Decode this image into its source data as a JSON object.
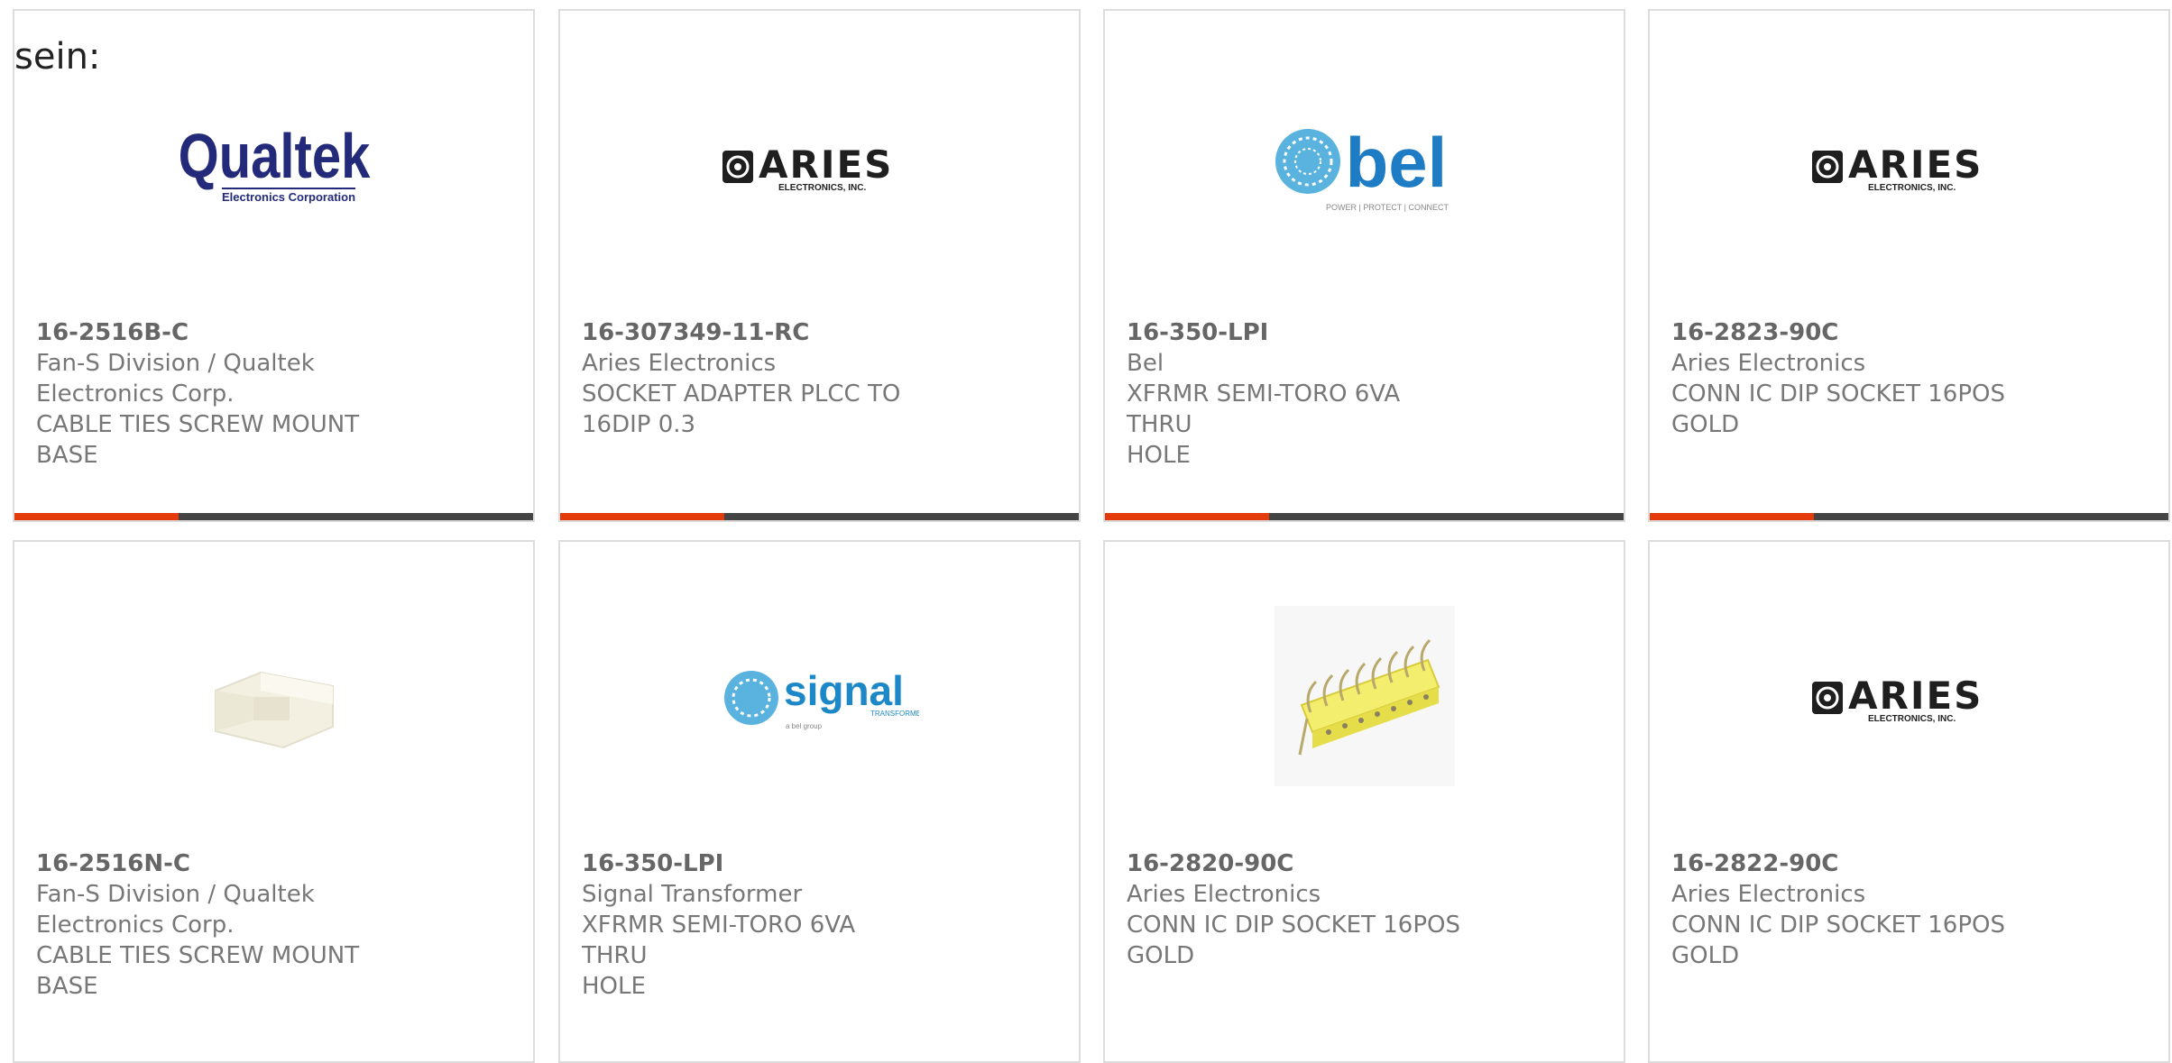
{
  "prefix_text": "sein:",
  "colors": {
    "accent": "#e33b0c",
    "bar": "#444444",
    "border": "#dcdcdc"
  },
  "products": [
    {
      "logo": "qualtek-logo",
      "logo_text": "Qualtek",
      "logo_sub": "Electronics Corporation",
      "part_number": "16-2516B-C",
      "manufacturer_lines": [
        "Fan-S Division / Qualtek",
        "Electronics Corp."
      ],
      "description_lines": [
        "CABLE TIES SCREW MOUNT",
        "BASE"
      ]
    },
    {
      "logo": "aries-logo",
      "logo_text": "ARIES",
      "logo_sub": "ELECTRONICS, INC.",
      "part_number": "16-307349-11-RC",
      "manufacturer_lines": [
        "Aries Electronics"
      ],
      "description_lines": [
        "SOCKET ADAPTER PLCC TO",
        "16DIP 0.3"
      ]
    },
    {
      "logo": "bel-logo",
      "logo_text": "bel",
      "logo_sub": "POWER | PROTECT | CONNECT",
      "part_number": "16-350-LPI",
      "manufacturer_lines": [
        "Bel"
      ],
      "description_lines": [
        "XFRMR SEMI-TORO 6VA THRU",
        "HOLE"
      ]
    },
    {
      "logo": "aries-logo",
      "logo_text": "ARIES",
      "logo_sub": "ELECTRONICS, INC.",
      "part_number": "16-2823-90C",
      "manufacturer_lines": [
        "Aries Electronics"
      ],
      "description_lines": [
        "CONN IC DIP SOCKET 16POS",
        "GOLD"
      ]
    },
    {
      "logo": "cable-tie-mount-image",
      "part_number": "16-2516N-C",
      "manufacturer_lines": [
        "Fan-S Division / Qualtek",
        "Electronics Corp."
      ],
      "description_lines": [
        "CABLE TIES SCREW MOUNT",
        "BASE"
      ]
    },
    {
      "logo": "signal-logo",
      "logo_text": "signal",
      "logo_sub": "TRANSFORMER",
      "logo_sub2": "a bel group",
      "part_number": "16-350-LPI",
      "manufacturer_lines": [
        "Signal Transformer"
      ],
      "description_lines": [
        "XFRMR SEMI-TORO 6VA THRU",
        "HOLE"
      ]
    },
    {
      "logo": "dip-socket-image",
      "part_number": "16-2820-90C",
      "manufacturer_lines": [
        "Aries Electronics"
      ],
      "description_lines": [
        "CONN IC DIP SOCKET 16POS",
        "GOLD"
      ]
    },
    {
      "logo": "aries-logo",
      "logo_text": "ARIES",
      "logo_sub": "ELECTRONICS, INC.",
      "part_number": "16-2822-90C",
      "manufacturer_lines": [
        "Aries Electronics"
      ],
      "description_lines": [
        "CONN IC DIP SOCKET 16POS",
        "GOLD"
      ]
    }
  ]
}
